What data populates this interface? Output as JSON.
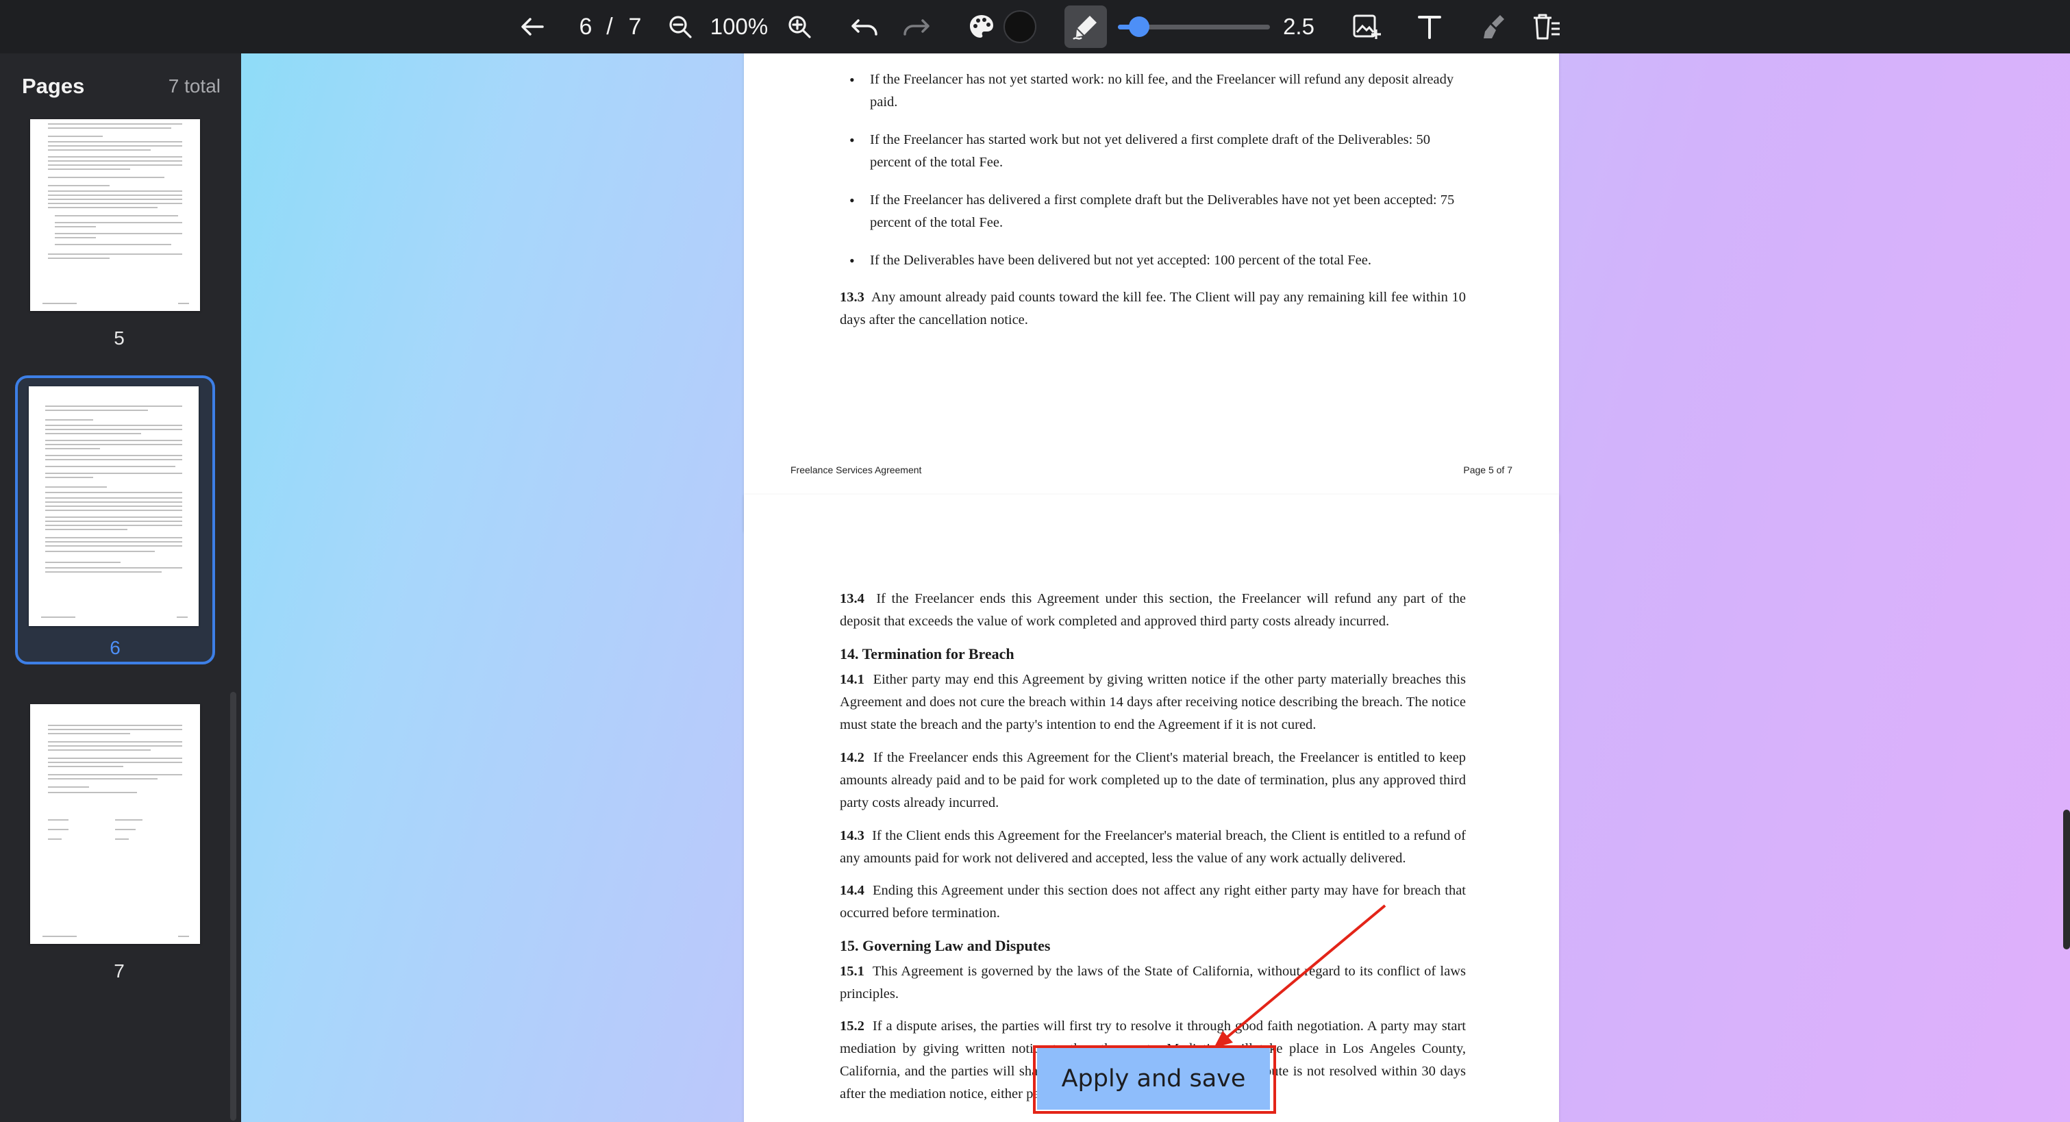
{
  "toolbar": {
    "current_page": "6",
    "separator": "/",
    "total_pages": "7",
    "zoom": "100%",
    "stroke_width": "2.5",
    "stroke_width_fraction": 0.07,
    "icons": [
      "back-arrow-icon",
      "zoom-out-icon",
      "zoom-in-icon",
      "undo-icon",
      "redo-icon",
      "palette-icon",
      "color-swatch",
      "pen-icon",
      "add-image-icon",
      "text-icon",
      "eraser-icon",
      "delete-page-icon"
    ],
    "accent": "#4d8ff7"
  },
  "sidebar": {
    "title": "Pages",
    "total": "7 total",
    "thumbnails": [
      {
        "label": "5"
      },
      {
        "label": "6",
        "selected": true
      },
      {
        "label": "7"
      }
    ]
  },
  "doc": {
    "page5": {
      "bullets": [
        "If the Freelancer has not yet started work: no kill fee, and the Freelancer will refund any deposit already paid.",
        "If the Freelancer has started work but not yet delivered a first complete draft of the Deliverables: 50 percent of the total Fee.",
        "If the Freelancer has delivered a first complete draft but the Deliverables have not yet been accepted: 75 percent of the total Fee.",
        "If the Deliverables have been delivered but not yet accepted: 100 percent of the total Fee."
      ],
      "p13_3_num": "13.3",
      "p13_3": "Any amount already paid counts toward the kill fee. The Client will pay any remaining kill fee within 10 days after the cancellation notice.",
      "footer_left": "Freelance Services Agreement",
      "footer_right": "Page 5 of 7"
    },
    "page6": {
      "p13_4_num": "13.4",
      "p13_4": "If the Freelancer ends this Agreement under this section, the Freelancer will refund any part of the deposit that exceeds the value of work completed and approved third party costs already incurred.",
      "h14": "14. Termination for Breach",
      "p14_1_num": "14.1",
      "p14_1": "Either party may end this Agreement by giving written notice if the other party materially breaches this Agreement and does not cure the breach within 14 days after receiving notice describing the breach. The notice must state the breach and the party's intention to end the Agreement if it is not cured.",
      "p14_2_num": "14.2",
      "p14_2": "If the Freelancer ends this Agreement for the Client's material breach, the Freelancer is entitled to keep amounts already paid and to be paid for work completed up to the date of termination, plus any approved third party costs already incurred.",
      "p14_3_num": "14.3",
      "p14_3": "If the Client ends this Agreement for the Freelancer's material breach, the Client is entitled to a refund of any amounts paid for work not delivered and accepted, less the value of any work actually delivered.",
      "p14_4_num": "14.4",
      "p14_4": "Ending this Agreement under this section does not affect any right either party may have for breach that occurred before termination.",
      "h15": "15. Governing Law and Disputes",
      "p15_1_num": "15.1",
      "p15_1": "This Agreement is governed by the laws of the State of California, without regard to its conflict of laws principles.",
      "p15_2_num": "15.2",
      "p15_2": "If a dispute arises, the parties will first try to resolve it through good faith negotiation. A party may start mediation by giving written notice to the other party. Mediation will take place in Los Angeles County, California, and the parties will share the mediator's fees equally. If the dispute is not resolved within 30 days after the mediation notice, either party may pursue binding arbitration."
    }
  },
  "apply_button": {
    "label": "Apply and save"
  }
}
